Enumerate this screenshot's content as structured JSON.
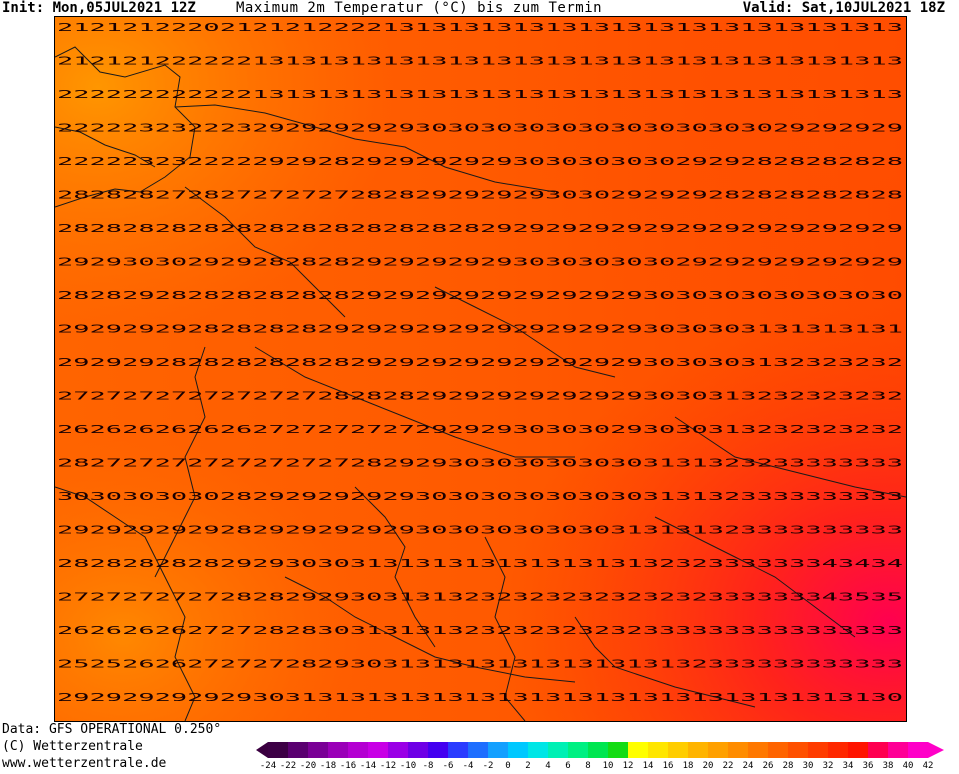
{
  "header": {
    "init": "Init: Mon,05JUL2021 12Z",
    "title": "Maximum 2m Temperatur (°C) bis zum Termin",
    "valid": "Valid: Sat,10JUL2021 18Z"
  },
  "footer": {
    "data_source": "Data: GFS OPERATIONAL 0.250°",
    "copyright": "(C) Wetterzentrale",
    "url": "www.wetterzentrale.de"
  },
  "legend": {
    "labels": [
      "-24",
      "-22",
      "-20",
      "-18",
      "-16",
      "-14",
      "-12",
      "-10",
      "-8",
      "-6",
      "-4",
      "-2",
      "0",
      "2",
      "4",
      "6",
      "8",
      "10",
      "12",
      "14",
      "16",
      "18",
      "20",
      "22",
      "24",
      "26",
      "28",
      "30",
      "32",
      "34",
      "36",
      "38",
      "40",
      "42"
    ],
    "colors": [
      "#3d0045",
      "#5a0070",
      "#7a0096",
      "#9a00b8",
      "#b400d2",
      "#c800e6",
      "#9a00e6",
      "#6e00e6",
      "#4400f0",
      "#2a3cff",
      "#1e6eff",
      "#14a0ff",
      "#00c8ff",
      "#00e6e6",
      "#00f0b4",
      "#00f082",
      "#00e650",
      "#14dc14",
      "#ffff00",
      "#ffe600",
      "#ffcd00",
      "#ffb400",
      "#ffa000",
      "#ff8c00",
      "#ff7800",
      "#ff6400",
      "#ff5000",
      "#ff3c00",
      "#ff2800",
      "#ff1400",
      "#ff0050",
      "#ff0096",
      "#ff00c8"
    ]
  },
  "map": {
    "row_values": [
      "2121212220212121222213131313131313131313131313131313",
      "2121212222221313131313131313131313131313131313131313",
      "2222222222221313131313131313131313131313131313131313",
      "2222232322232929292929303030303030303030303029292929",
      "2222232322222929282929292929303030303029292828282828",
      "2828282728272727272828292929293030292929282828282828",
      "2828282828282828282828282829292929292929292929292929",
      "2929303029292828282929292929303030303029292929292929",
      "2828292828282828282929292929292929293030303030303030",
      "2929292928282828292929292929292929293030303131313131",
      "2929292828282828282929292929292929293030303132323232",
      "2727272727272727282828292929292929293030313232323232",
      "2626262626262727272727292929303030293030313232323232",
      "2827272727272727272829293030303030303131323233333333",
      "3030303030282929292929303030303030303131323333333333",
      "2929292929282929292929303030303030313131323333333333",
      "2828282828292930303131313131313131313232333333343434",
      "2727272727282829293031313232323232323232333333343535",
      "2626262627272828303131313232323232323333333333333333",
      "2525262627272728293031313131313131313132333333333333",
      "2929292929293031313131313131313131313131313131313130"
    ]
  }
}
